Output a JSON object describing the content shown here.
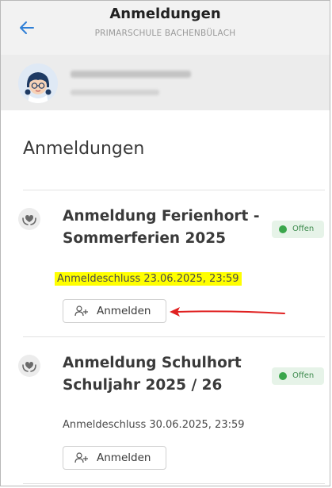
{
  "header": {
    "title": "Anmeldungen",
    "subtitle": "PRIMARSCHULE BACHENBÜLACH",
    "back_icon": "arrow-left-icon",
    "accent_color": "#2f7fd6"
  },
  "user": {
    "avatar_icon": "child-avatar-icon"
  },
  "section": {
    "title": "Anmeldungen"
  },
  "registrations": [
    {
      "title_line1": "Anmeldung Ferienhort -",
      "title_line2": "Sommerferien 2025",
      "status": "Offen",
      "deadline": "Anmeldeschluss 23.06.2025, 23:59",
      "deadline_highlighted": true,
      "button_label": "Anmelden",
      "icon": "hands-heart-icon"
    },
    {
      "title_line1": "Anmeldung Schulhort",
      "title_line2": "Schuljahr 2025 / 26",
      "status": "Offen",
      "deadline": "Anmeldeschluss 30.06.2025, 23:59",
      "deadline_highlighted": false,
      "button_label": "Anmelden",
      "icon": "hands-heart-icon"
    }
  ],
  "colors": {
    "status_open": "#3aa64b",
    "highlight": "#ffff00",
    "annotation_arrow": "#e02020"
  }
}
